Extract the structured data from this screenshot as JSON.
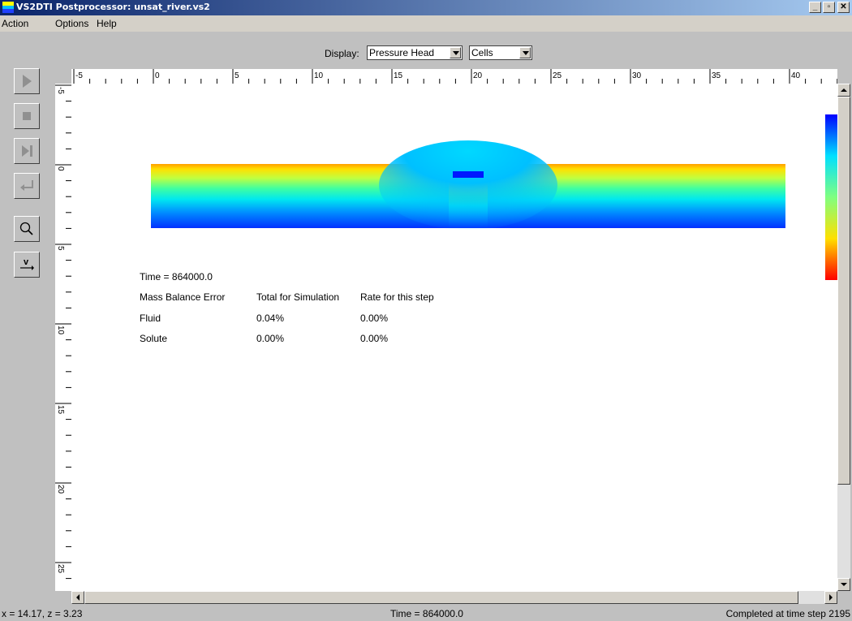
{
  "window": {
    "title": "VS2DTI Postprocessor: unsat_river.vs2"
  },
  "menu": [
    "Action",
    "Options",
    "Help"
  ],
  "toolbar": {
    "display_label": "Display:",
    "variable_value": "Pressure Head",
    "mode_value": "Cells",
    "buttons": [
      "play-icon",
      "stop-icon",
      "step-icon",
      "rewind-icon",
      "zoom-icon",
      "velocity-icon"
    ]
  },
  "rulers": {
    "x_labels": [
      "-5",
      "0",
      "5",
      "10",
      "15",
      "20",
      "25",
      "30",
      "35",
      "40"
    ],
    "y_labels": [
      "-5",
      "0",
      "5",
      "10",
      "15",
      "20",
      "25"
    ]
  },
  "mass_balance": {
    "time": "Time = 864000.0",
    "headers": [
      "Mass Balance Error",
      "Total for Simulation",
      "Rate for this step"
    ],
    "rows": [
      [
        "Fluid",
        "0.04%",
        "0.00%"
      ],
      [
        "Solute",
        "0.00%",
        "0.00%"
      ]
    ]
  },
  "colors": {
    "high": "#ff0000",
    "low": "#0000ff",
    "titlebar": "#0a246a"
  },
  "status": {
    "coords": "x = 14.17, z = 3.23",
    "time": "Time = 864000.0",
    "progress": "Completed at time step 2195"
  }
}
